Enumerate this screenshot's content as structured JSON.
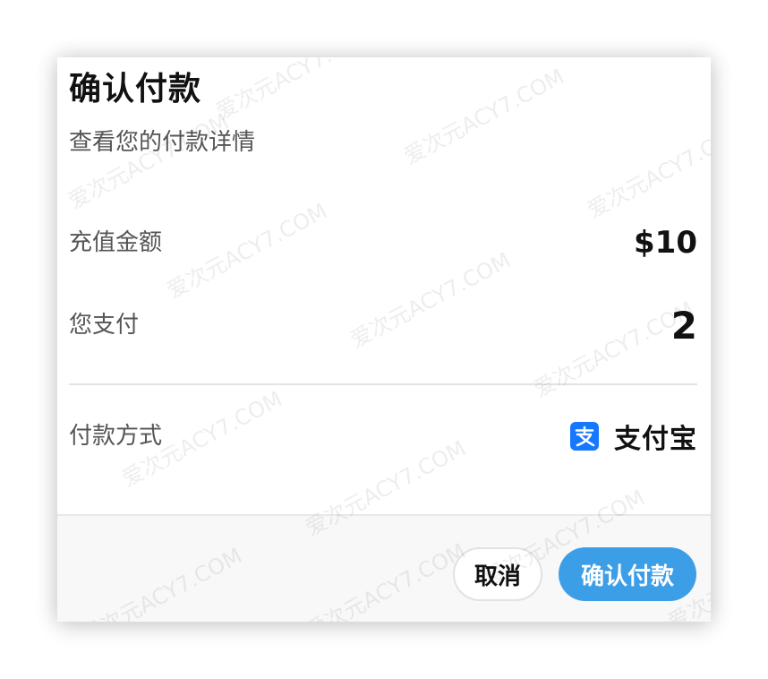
{
  "dialog": {
    "title": "确认付款",
    "subtitle": "查看您的付款详情"
  },
  "details": {
    "amount_label": "充值金额",
    "amount_value": "$10",
    "pay_label": "您支付",
    "pay_value": "2",
    "method_label": "付款方式",
    "method_name": "支付宝",
    "method_icon": "alipay-icon"
  },
  "footer": {
    "cancel_label": "取消",
    "confirm_label": "确认付款"
  },
  "watermark": {
    "text": "爱次元ACY7.COM"
  },
  "colors": {
    "confirm_button": "#3d9ee8",
    "alipay_brand": "#1677ff"
  }
}
